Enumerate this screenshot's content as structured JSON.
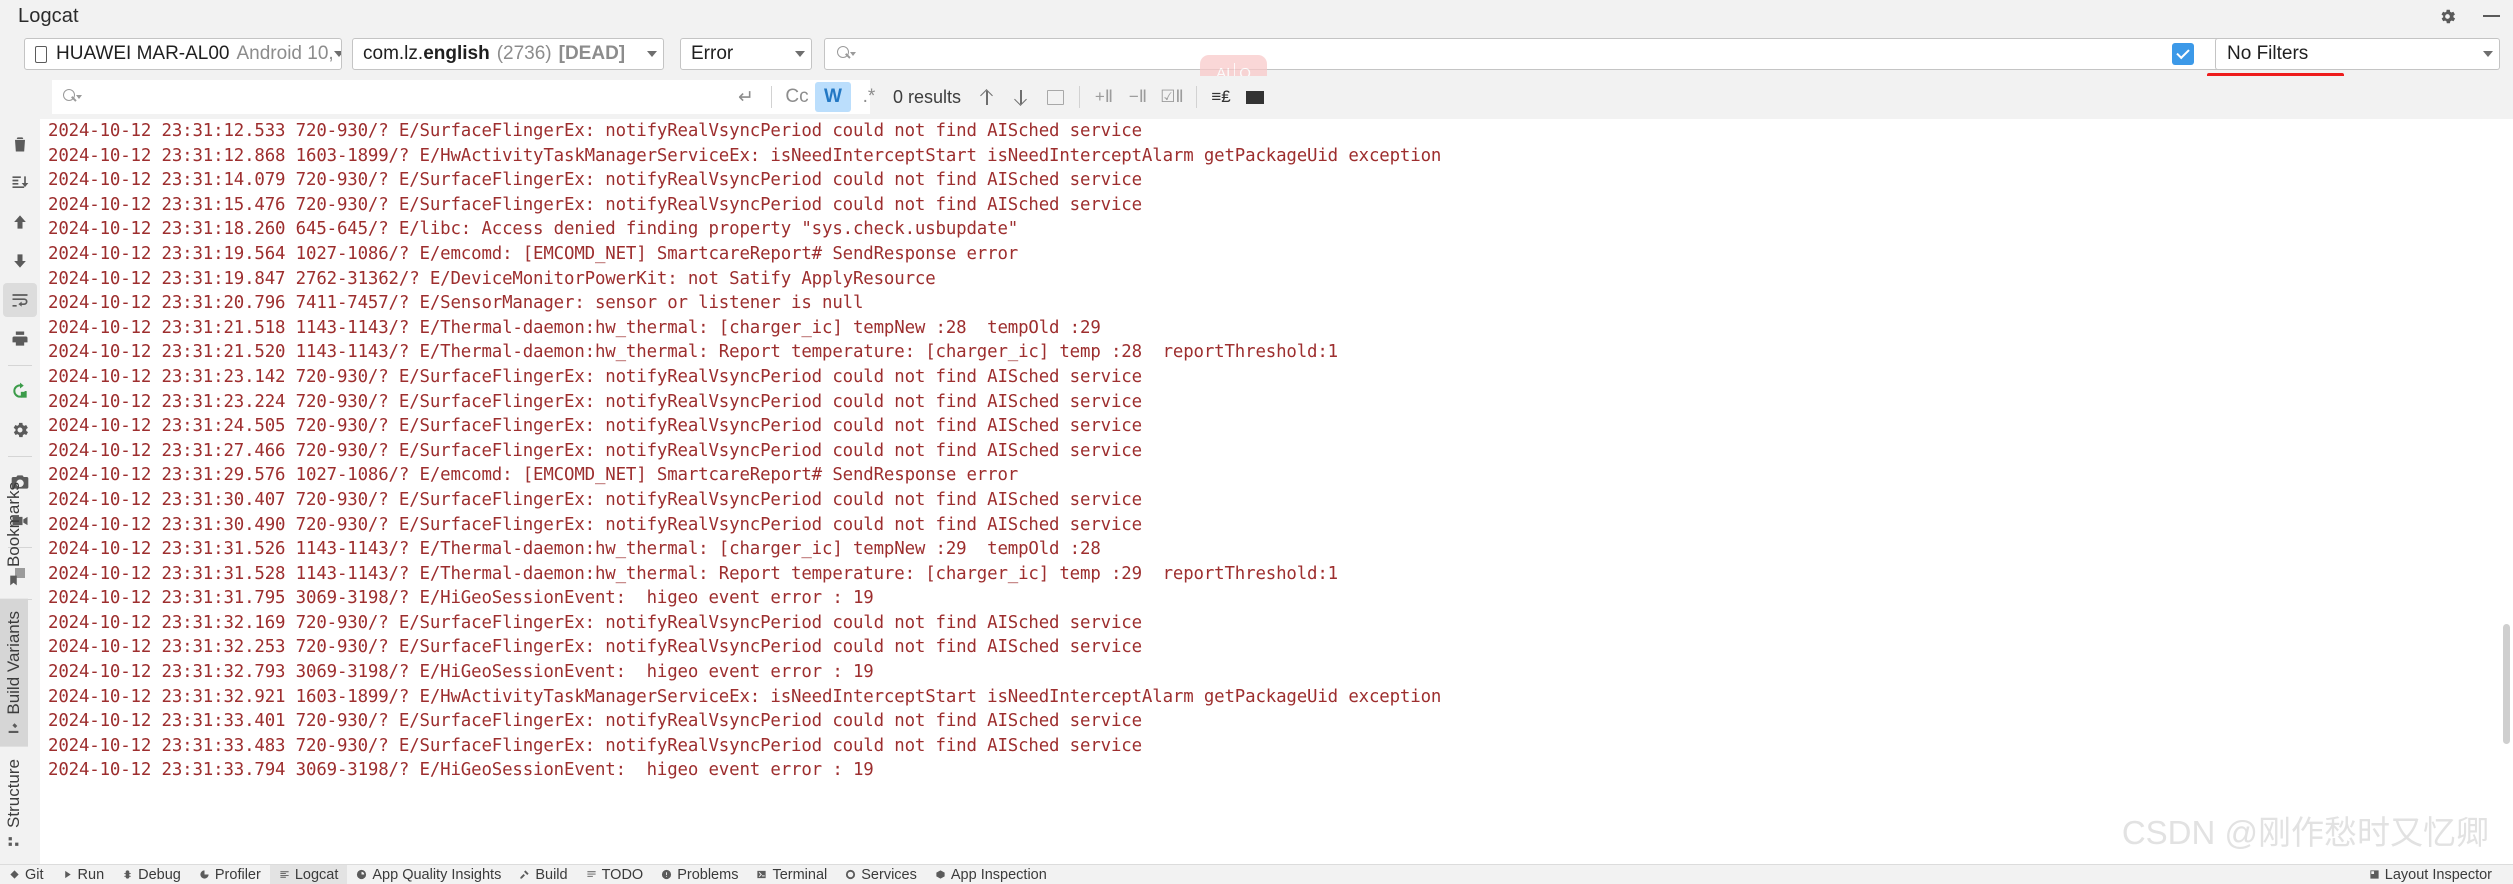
{
  "window": {
    "tool_title": "Logcat",
    "settings_icon": "gear-icon",
    "minimize_icon": "minimize-icon"
  },
  "toolbar": {
    "device": {
      "icon": "phone-icon",
      "name": "HUAWEI MAR-AL00",
      "os": "Android 10,",
      "caret": "chevron-down-icon"
    },
    "process": {
      "package_prefix": "com.lz.",
      "package_suffix": "english",
      "pid": "(2736)",
      "state": "[DEAD]",
      "caret": "chevron-down-icon"
    },
    "level": {
      "value": "Error",
      "caret": "chevron-down-icon"
    },
    "query": {
      "value": "",
      "placeholder": "",
      "icon": "search-icon"
    },
    "ai_overlay": {
      "badge": "AI",
      "search_glyph": "Q"
    },
    "filters_checkbox": {
      "label": "filters-enabled-checkbox",
      "checked": true
    },
    "filter_preset": {
      "value": "No Filters",
      "caret": "chevron-down-icon"
    },
    "accent_red": "#ee1c1c",
    "accent_blue": "#3c99e8"
  },
  "findbar": {
    "input_value": "",
    "search_icon": "search-icon",
    "new_line_icon": "new-line-icon",
    "options": [
      {
        "label": "Cc",
        "name": "match-case-toggle",
        "active": false
      },
      {
        "label": "W",
        "name": "match-words-toggle",
        "active": true
      },
      {
        "label": ".*",
        "name": "regex-toggle",
        "active": false
      }
    ],
    "results": "0 results",
    "prev_icon": "arrow-up-icon",
    "next_icon": "arrow-down-icon",
    "open_in_icon": "open-in-new-window-icon",
    "add_filter_icon": "add-filter-icon",
    "remove_filter_icon": "remove-filter-icon",
    "select_filter_icon": "select-filter-icon",
    "configure_icon": "configure-columns-icon",
    "funnel_icon": "filter-funnel-icon"
  },
  "rail": [
    {
      "name": "clear-logcat-button",
      "icon": "trash-icon",
      "selected": false
    },
    {
      "name": "scroll-to-end-button",
      "icon": "scroll-to-end-icon",
      "selected": false
    },
    {
      "name": "previous-occurrence-button",
      "icon": "arrow-up-icon",
      "selected": false
    },
    {
      "name": "next-occurrence-button",
      "icon": "arrow-down-icon",
      "selected": false
    },
    {
      "name": "soft-wrap-button",
      "icon": "soft-wrap-icon",
      "selected": true
    },
    {
      "name": "print-button",
      "icon": "print-icon",
      "selected": false
    },
    {
      "name": "restart-logcat-button",
      "icon": "restart-icon",
      "selected": false
    },
    {
      "name": "logcat-settings-button",
      "icon": "gear-icon",
      "selected": false
    },
    {
      "name": "screenshot-button",
      "icon": "camera-icon",
      "selected": false
    },
    {
      "name": "screen-record-button",
      "icon": "video-camera-icon",
      "selected": false
    },
    {
      "name": "stop-button",
      "icon": "stop-square-icon",
      "selected": false
    },
    {
      "name": "help-button",
      "icon": "question-mark-icon",
      "selected": false
    }
  ],
  "left_tabs": [
    {
      "label": "Bookmarks",
      "icon": "bookmark-icon",
      "active": false
    },
    {
      "label": "Build Variants",
      "icon": "build-variants-icon",
      "active": true
    },
    {
      "label": "Structure",
      "icon": "structure-icon",
      "active": false
    }
  ],
  "log": {
    "text_color": "#9d2e2e",
    "lines": [
      "2024-10-12 23:31:12.533 720-930/? E/SurfaceFlingerEx: notifyRealVsyncPeriod could not find AISched service",
      "2024-10-12 23:31:12.868 1603-1899/? E/HwActivityTaskManagerServiceEx: isNeedInterceptStart isNeedInterceptAlarm getPackageUid exception",
      "2024-10-12 23:31:14.079 720-930/? E/SurfaceFlingerEx: notifyRealVsyncPeriod could not find AISched service",
      "2024-10-12 23:31:15.476 720-930/? E/SurfaceFlingerEx: notifyRealVsyncPeriod could not find AISched service",
      "2024-10-12 23:31:18.260 645-645/? E/libc: Access denied finding property \"sys.check.usbupdate\"",
      "2024-10-12 23:31:19.564 1027-1086/? E/emcomd: [EMCOMD_NET] SmartcareReport# SendResponse error",
      "2024-10-12 23:31:19.847 2762-31362/? E/DeviceMonitorPowerKit: not Satify ApplyResource",
      "2024-10-12 23:31:20.796 7411-7457/? E/SensorManager: sensor or listener is null",
      "2024-10-12 23:31:21.518 1143-1143/? E/Thermal-daemon:hw_thermal: [charger_ic] tempNew :28  tempOld :29",
      "2024-10-12 23:31:21.520 1143-1143/? E/Thermal-daemon:hw_thermal: Report temperature: [charger_ic] temp :28  reportThreshold:1",
      "2024-10-12 23:31:23.142 720-930/? E/SurfaceFlingerEx: notifyRealVsyncPeriod could not find AISched service",
      "2024-10-12 23:31:23.224 720-930/? E/SurfaceFlingerEx: notifyRealVsyncPeriod could not find AISched service",
      "2024-10-12 23:31:24.505 720-930/? E/SurfaceFlingerEx: notifyRealVsyncPeriod could not find AISched service",
      "2024-10-12 23:31:27.466 720-930/? E/SurfaceFlingerEx: notifyRealVsyncPeriod could not find AISched service",
      "2024-10-12 23:31:29.576 1027-1086/? E/emcomd: [EMCOMD_NET] SmartcareReport# SendResponse error",
      "2024-10-12 23:31:30.407 720-930/? E/SurfaceFlingerEx: notifyRealVsyncPeriod could not find AISched service",
      "2024-10-12 23:31:30.490 720-930/? E/SurfaceFlingerEx: notifyRealVsyncPeriod could not find AISched service",
      "2024-10-12 23:31:31.526 1143-1143/? E/Thermal-daemon:hw_thermal: [charger_ic] tempNew :29  tempOld :28",
      "2024-10-12 23:31:31.528 1143-1143/? E/Thermal-daemon:hw_thermal: Report temperature: [charger_ic] temp :29  reportThreshold:1",
      "2024-10-12 23:31:31.795 3069-3198/? E/HiGeoSessionEvent:  higeo event error : 19",
      "2024-10-12 23:31:32.169 720-930/? E/SurfaceFlingerEx: notifyRealVsyncPeriod could not find AISched service",
      "2024-10-12 23:31:32.253 720-930/? E/SurfaceFlingerEx: notifyRealVsyncPeriod could not find AISched service",
      "2024-10-12 23:31:32.793 3069-3198/? E/HiGeoSessionEvent:  higeo event error : 19",
      "2024-10-12 23:31:32.921 1603-1899/? E/HwActivityTaskManagerServiceEx: isNeedInterceptStart isNeedInterceptAlarm getPackageUid exception",
      "2024-10-12 23:31:33.401 720-930/? E/SurfaceFlingerEx: notifyRealVsyncPeriod could not find AISched service",
      "2024-10-12 23:31:33.483 720-930/? E/SurfaceFlingerEx: notifyRealVsyncPeriod could not find AISched service",
      "2024-10-12 23:31:33.794 3069-3198/? E/HiGeoSessionEvent:  higeo event error : 19"
    ]
  },
  "watermark": "CSDN @刚作愁时又忆卿",
  "statusbar": {
    "tabs": [
      {
        "label": "Git",
        "icon": "git-icon",
        "active": false
      },
      {
        "label": "Run",
        "icon": "run-icon",
        "active": false
      },
      {
        "label": "Debug",
        "icon": "debug-icon",
        "active": false
      },
      {
        "label": "Profiler",
        "icon": "profiler-icon",
        "active": false
      },
      {
        "label": "Logcat",
        "icon": "logcat-icon",
        "active": true
      },
      {
        "label": "App Quality Insights",
        "icon": "app-quality-insights-icon",
        "active": false
      },
      {
        "label": "Build",
        "icon": "build-icon",
        "active": false
      },
      {
        "label": "TODO",
        "icon": "todo-icon",
        "active": false
      },
      {
        "label": "Problems",
        "icon": "problems-icon",
        "active": false
      },
      {
        "label": "Terminal",
        "icon": "terminal-icon",
        "active": false
      },
      {
        "label": "Services",
        "icon": "services-icon",
        "active": false
      },
      {
        "label": "App Inspection",
        "icon": "app-inspection-icon",
        "active": false
      }
    ],
    "right_tab": {
      "label": "Layout Inspector",
      "icon": "layout-inspector-icon"
    }
  }
}
